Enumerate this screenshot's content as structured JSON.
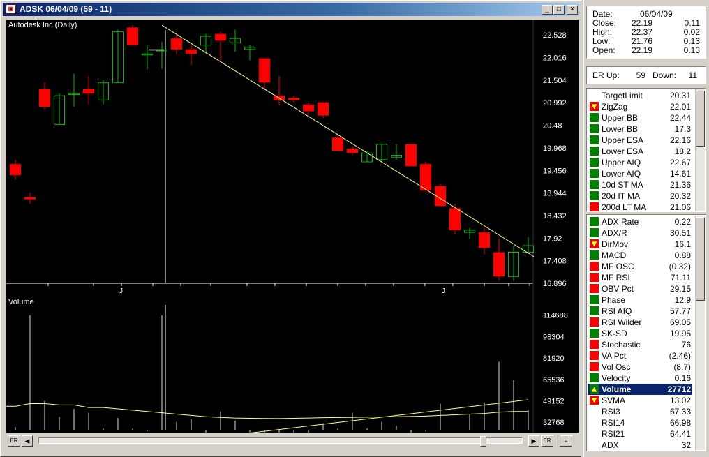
{
  "window": {
    "title": "ADSK 06/04/09 (59 - 11)",
    "app_icon": "chart-app-icon",
    "min_label": "_",
    "max_label": "□",
    "close_label": "×"
  },
  "chart": {
    "price_label": "Autodesk Inc (Daily)",
    "volume_label": "Volume",
    "price_ticks": [
      "22.528",
      "22.016",
      "21.504",
      "20.992",
      "20.48",
      "19.968",
      "19.456",
      "18.944",
      "18.432",
      "17.92",
      "17.408",
      "16.896"
    ],
    "volume_ticks": [
      "114688",
      "98304",
      "81920",
      "65536",
      "49152",
      "32768"
    ],
    "month_labels": [
      "J",
      "J"
    ],
    "colors": {
      "up": "#00c000",
      "down": "#ff0000",
      "line": "#ffff80",
      "axis": "#ffffff",
      "bg": "#000000"
    }
  },
  "chart_data": {
    "type": "candlestick",
    "title": "Autodesk Inc (Daily)",
    "ylim": [
      16.896,
      22.8
    ],
    "candles": [
      {
        "o": 19.6,
        "h": 19.7,
        "l": 19.25,
        "c": 19.35
      },
      {
        "o": 18.85,
        "h": 18.95,
        "l": 18.7,
        "c": 18.8
      },
      {
        "o": 21.3,
        "h": 21.45,
        "l": 20.85,
        "c": 20.9
      },
      {
        "o": 20.5,
        "h": 21.2,
        "l": 20.5,
        "c": 21.15
      },
      {
        "o": 21.2,
        "h": 21.65,
        "l": 20.9,
        "c": 21.2
      },
      {
        "o": 21.3,
        "h": 21.6,
        "l": 20.95,
        "c": 21.2
      },
      {
        "o": 21.05,
        "h": 21.5,
        "l": 20.95,
        "c": 21.45
      },
      {
        "o": 21.45,
        "h": 22.65,
        "l": 21.45,
        "c": 22.6
      },
      {
        "o": 22.7,
        "h": 22.75,
        "l": 22.3,
        "c": 22.3
      },
      {
        "o": 22.1,
        "h": 22.3,
        "l": 21.75,
        "c": 22.1
      },
      {
        "o": 22.19,
        "h": 22.37,
        "l": 21.76,
        "c": 22.19
      },
      {
        "o": 22.45,
        "h": 22.55,
        "l": 22.1,
        "c": 22.2
      },
      {
        "o": 22.2,
        "h": 22.3,
        "l": 21.85,
        "c": 22.1
      },
      {
        "o": 22.3,
        "h": 22.55,
        "l": 22.1,
        "c": 22.5
      },
      {
        "o": 22.55,
        "h": 22.6,
        "l": 21.95,
        "c": 22.4
      },
      {
        "o": 22.35,
        "h": 22.65,
        "l": 22.15,
        "c": 22.45
      },
      {
        "o": 22.2,
        "h": 22.3,
        "l": 21.95,
        "c": 22.25
      },
      {
        "o": 22.0,
        "h": 22.0,
        "l": 21.3,
        "c": 21.45
      },
      {
        "o": 21.15,
        "h": 21.6,
        "l": 20.95,
        "c": 21.05
      },
      {
        "o": 21.1,
        "h": 21.15,
        "l": 21.0,
        "c": 21.05
      },
      {
        "o": 20.95,
        "h": 21.0,
        "l": 20.7,
        "c": 20.8
      },
      {
        "o": 21.0,
        "h": 21.0,
        "l": 20.65,
        "c": 20.7
      },
      {
        "o": 20.2,
        "h": 20.3,
        "l": 19.9,
        "c": 19.9
      },
      {
        "o": 19.95,
        "h": 20.0,
        "l": 19.8,
        "c": 19.85
      },
      {
        "o": 19.65,
        "h": 19.9,
        "l": 19.65,
        "c": 19.85
      },
      {
        "o": 19.7,
        "h": 20.05,
        "l": 19.65,
        "c": 20.05
      },
      {
        "o": 19.75,
        "h": 20.05,
        "l": 19.7,
        "c": 19.8
      },
      {
        "o": 20.05,
        "h": 20.05,
        "l": 19.55,
        "c": 19.55
      },
      {
        "o": 19.6,
        "h": 19.65,
        "l": 19.0,
        "c": 19.0
      },
      {
        "o": 19.1,
        "h": 19.15,
        "l": 18.65,
        "c": 18.65
      },
      {
        "o": 18.6,
        "h": 18.7,
        "l": 18.0,
        "c": 18.1
      },
      {
        "o": 18.05,
        "h": 18.15,
        "l": 17.9,
        "c": 18.1
      },
      {
        "o": 18.05,
        "h": 18.15,
        "l": 17.55,
        "c": 17.7
      },
      {
        "o": 17.6,
        "h": 17.9,
        "l": 16.95,
        "c": 17.05
      },
      {
        "o": 17.05,
        "h": 17.75,
        "l": 16.95,
        "c": 17.6
      },
      {
        "o": 17.6,
        "h": 17.95,
        "l": 17.6,
        "c": 17.75
      }
    ],
    "trendline": {
      "from_index": 10,
      "from": 22.75,
      "to_index": 35,
      "to": 17.5
    },
    "volume": [
      29000,
      114688,
      49000,
      37000,
      43000,
      40000,
      28000,
      36000,
      28000,
      26000,
      114688,
      33000,
      35000,
      23000,
      41000,
      34000,
      25000,
      22000,
      24000,
      19000,
      20000,
      32000,
      28000,
      40000,
      28000,
      33000,
      30000,
      22000,
      26000,
      47000,
      27000,
      39000,
      48000,
      79000,
      65000,
      42000
    ],
    "volume_ylim": [
      27000,
      122000
    ],
    "volume_ma": [
      45000,
      47000,
      47000,
      46000,
      46000,
      44000,
      44000,
      43000,
      42000,
      41000,
      40000,
      39000,
      38000,
      37000,
      36500,
      36000,
      35800,
      35700,
      35600,
      35800,
      36000,
      36300,
      36400,
      36500,
      36700,
      36900,
      37000,
      37200,
      37500,
      38000,
      38500,
      39000,
      39500,
      40500,
      41000,
      41000
    ],
    "volume_trendline": {
      "from_index": 10,
      "from": 16000,
      "to_index": 35,
      "to": 50000
    }
  },
  "data_box": {
    "date_label": "Date:",
    "date_value": "06/04/09",
    "rows": [
      {
        "label": "Close:",
        "value": "22.19",
        "change": "0.11"
      },
      {
        "label": "High:",
        "value": "22.37",
        "change": "0.02"
      },
      {
        "label": "Low:",
        "value": "21.76",
        "change": "0.13"
      },
      {
        "label": "Open:",
        "value": "22.19",
        "change": "0.13"
      }
    ]
  },
  "er_box": {
    "up_label": "ER Up:",
    "up_value": "59",
    "down_label": "Down:",
    "down_value": "11"
  },
  "indicators_top": [
    {
      "name": "TargetLimit",
      "value": "20.31",
      "signal": "none"
    },
    {
      "name": "ZigZag",
      "value": "22.01",
      "signal": "red-down"
    },
    {
      "name": "Upper BB",
      "value": "22.44",
      "signal": "green"
    },
    {
      "name": "Lower BB",
      "value": "17.3",
      "signal": "green"
    },
    {
      "name": "Upper ESA",
      "value": "22.16",
      "signal": "green"
    },
    {
      "name": "Lower ESA",
      "value": "18.2",
      "signal": "green"
    },
    {
      "name": "Upper AIQ",
      "value": "22.67",
      "signal": "green"
    },
    {
      "name": "Lower AIQ",
      "value": "14.61",
      "signal": "green"
    },
    {
      "name": "10d ST MA",
      "value": "21.36",
      "signal": "green"
    },
    {
      "name": "20d IT MA",
      "value": "20.32",
      "signal": "green"
    },
    {
      "name": "200d LT MA",
      "value": "21.06",
      "signal": "red"
    }
  ],
  "indicators_bottom": [
    {
      "name": "ADX Rate",
      "value": "0.22",
      "signal": "green"
    },
    {
      "name": "ADX/R",
      "value": "30.51",
      "signal": "green"
    },
    {
      "name": "DirMov",
      "value": "16.1",
      "signal": "red-down"
    },
    {
      "name": "MACD",
      "value": "0.88",
      "signal": "green"
    },
    {
      "name": "MF OSC",
      "value": "(0.32)",
      "signal": "red"
    },
    {
      "name": "MF RSI",
      "value": "71.11",
      "signal": "red"
    },
    {
      "name": "OBV Pct",
      "value": "29.15",
      "signal": "red"
    },
    {
      "name": "Phase",
      "value": "12.9",
      "signal": "green"
    },
    {
      "name": "RSI AIQ",
      "value": "57.77",
      "signal": "green"
    },
    {
      "name": "RSI Wilder",
      "value": "69.05",
      "signal": "red"
    },
    {
      "name": "SK-SD",
      "value": "19.95",
      "signal": "green"
    },
    {
      "name": "Stochastic",
      "value": "76",
      "signal": "red"
    },
    {
      "name": "VA Pct",
      "value": "(2.46)",
      "signal": "red"
    },
    {
      "name": "Vol Osc",
      "value": "(8.7)",
      "signal": "red"
    },
    {
      "name": "Velocity",
      "value": "0.16",
      "signal": "green"
    },
    {
      "name": "Volume",
      "value": "27712",
      "signal": "green-up",
      "selected": true
    },
    {
      "name": "SVMA",
      "value": "13.02",
      "signal": "red-down"
    },
    {
      "name": "RSI3",
      "value": "67.33",
      "signal": "none"
    },
    {
      "name": "RSI14",
      "value": "66.98",
      "signal": "none"
    },
    {
      "name": "RSI21",
      "value": "64.41",
      "signal": "none"
    },
    {
      "name": "ADX",
      "value": "32",
      "signal": "none"
    }
  ],
  "scrollbar": {
    "left_er": "ER",
    "right_er": "ER",
    "left_arrow": "◀",
    "right_arrow": "▶",
    "menu_icon": "≡"
  }
}
